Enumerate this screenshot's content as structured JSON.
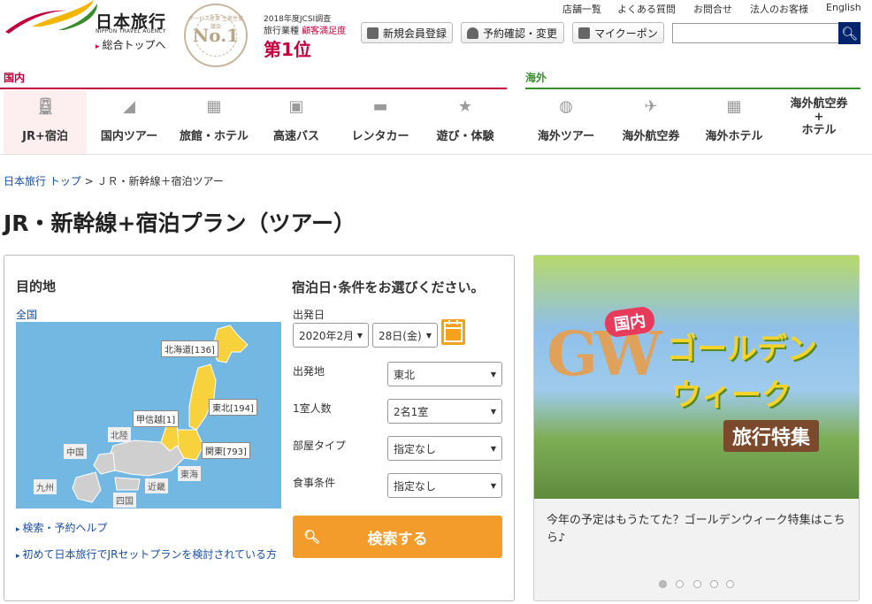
{
  "header": {
    "logo_text": "日本旅行",
    "logo_sub": "NIPPON TRAVEL AGENCY",
    "top_link": "総合トップへ",
    "seal_top": "サービス産業 生産性協議会",
    "seal_no1": "No.1",
    "award_line1": "2018年度JCSI調査",
    "award_line2a": "旅行業種",
    "award_line2b": "顧客満足度",
    "award_line3": "第1位",
    "utility_links": [
      "店舗一覧",
      "よくある質問",
      "お問合せ",
      "法人のお客様",
      "English"
    ],
    "buttons": {
      "register": "新規会員登録",
      "reservation": "予約確認・変更",
      "coupon": "マイクーポン"
    },
    "search_placeholder": ""
  },
  "nav": {
    "domestic_label": "国内",
    "international_label": "海外",
    "domestic_items": [
      "JR+宿泊",
      "国内ツアー",
      "旅館・ホテル",
      "高速バス",
      "レンタカー",
      "遊び・体験"
    ],
    "international_items": [
      "海外ツアー",
      "海外航空券",
      "海外ホテル",
      "海外航空券\n+\nホテル"
    ],
    "accent_domestic": "#c0003d",
    "accent_international": "#3a8d2f"
  },
  "breadcrumb": {
    "home": "日本旅行 トップ",
    "sep": ">",
    "current": "ＪＲ・新幹線＋宿泊ツアー"
  },
  "page_title": "JR・新幹線+宿泊プラン（ツアー）",
  "search": {
    "dest_title": "目的地",
    "nationwide": "全国",
    "map_regions": {
      "hokkaido": "北海道[136]",
      "tohoku": "東北[194]",
      "koshinetsu": "甲信越[1]",
      "kanto": "関東[793]",
      "hokuriku": "北陸",
      "chugoku": "中国",
      "tokai": "東海",
      "kinki": "近畿",
      "kyushu": "九州",
      "shikoku": "四国"
    },
    "help1": "検索・予約ヘルプ",
    "help2": "初めて日本旅行でJRセットプランを検討されている方",
    "cond_title": "宿泊日･条件をお選びください。",
    "depart_date_label": "出発日",
    "month_value": "2020年2月",
    "day_value": "28日(金)",
    "origin_label": "出発地",
    "origin_value": "東北",
    "people_label": "1室人数",
    "people_value": "2名1室",
    "room_label": "部屋タイプ",
    "room_value": "指定なし",
    "meal_label": "食事条件",
    "meal_value": "指定なし",
    "submit": "検索する"
  },
  "banner": {
    "tag": "国内",
    "gw": "GW",
    "line1": "ゴールデン",
    "line2": "ウィーク",
    "line3": "旅行特集",
    "text": "今年の予定はもうたてた？ゴールデンウィーク特集はこちら♪",
    "dots": 5,
    "active_dot": 1
  }
}
